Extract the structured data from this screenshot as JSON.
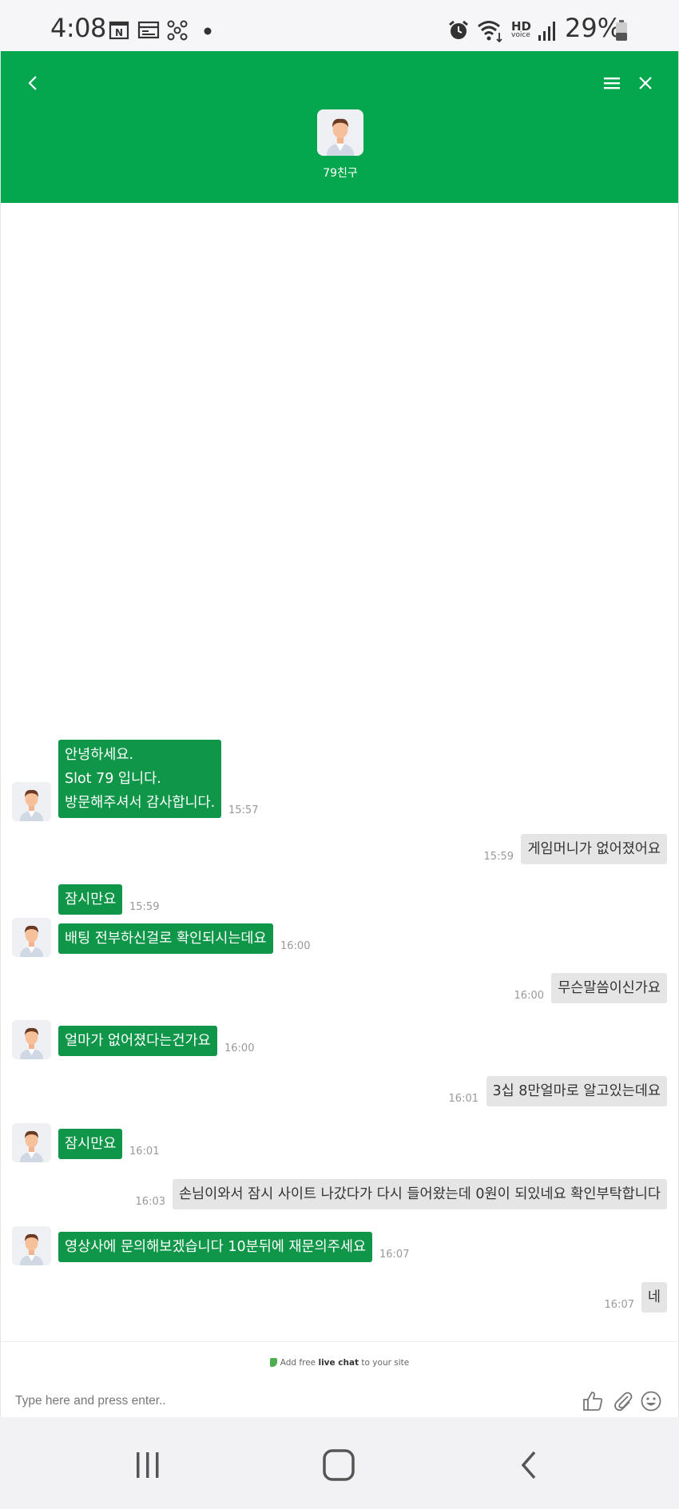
{
  "status_bar": {
    "time": "4:08",
    "battery": "29%",
    "left_icons": [
      "calendar-n-icon",
      "calendar-icon",
      "fan-icon",
      "dot-icon"
    ],
    "right_icons": [
      "alarm-icon",
      "wifi-icon",
      "hd-voice-icon",
      "signal-icon",
      "battery-icon"
    ],
    "hd_label": "HD",
    "voice_label": "voice"
  },
  "header": {
    "name": "79친구",
    "color": "#04a74e"
  },
  "messages": [
    {
      "side": "in",
      "lines": [
        "안녕하세요.",
        "Slot 79 입니다.",
        "방문해주셔서 감사합니다."
      ],
      "time": "15:57"
    },
    {
      "side": "out",
      "lines": [
        "게임머니가 없어졌어요"
      ],
      "time": "15:59"
    },
    {
      "side": "in",
      "lines": [
        "잠시만요"
      ],
      "time": "15:59"
    },
    {
      "side": "in",
      "lines": [
        "배팅 전부하신걸로 확인되시는데요"
      ],
      "time": "16:00"
    },
    {
      "side": "out",
      "lines": [
        "무슨말씀이신가요"
      ],
      "time": "16:00"
    },
    {
      "side": "in",
      "lines": [
        "얼마가 없어졌다는건가요"
      ],
      "time": "16:00"
    },
    {
      "side": "out",
      "lines": [
        "3십 8만얼마로 알고있는데요"
      ],
      "time": "16:01"
    },
    {
      "side": "in",
      "lines": [
        "잠시만요"
      ],
      "time": "16:01"
    },
    {
      "side": "out",
      "lines": [
        "손님이와서 잠시 사이트 나갔다가 다시 들어왔는데 0원이 되있네요 확인부탁합니다"
      ],
      "time": "16:03"
    },
    {
      "side": "in",
      "lines": [
        "영상사에 문의해보겠습니다 10분뒤에 재문의주세요"
      ],
      "time": "16:07"
    },
    {
      "side": "out",
      "lines": [
        "네"
      ],
      "time": "16:07"
    }
  ],
  "footer": {
    "brand_prefix": "Add free ",
    "brand_bold": "live chat",
    "brand_suffix": " to your site",
    "placeholder": "Type here and press enter.."
  },
  "colors": {
    "incoming_bubble": "#109649",
    "outgoing_bubble": "#e5e5e5"
  }
}
